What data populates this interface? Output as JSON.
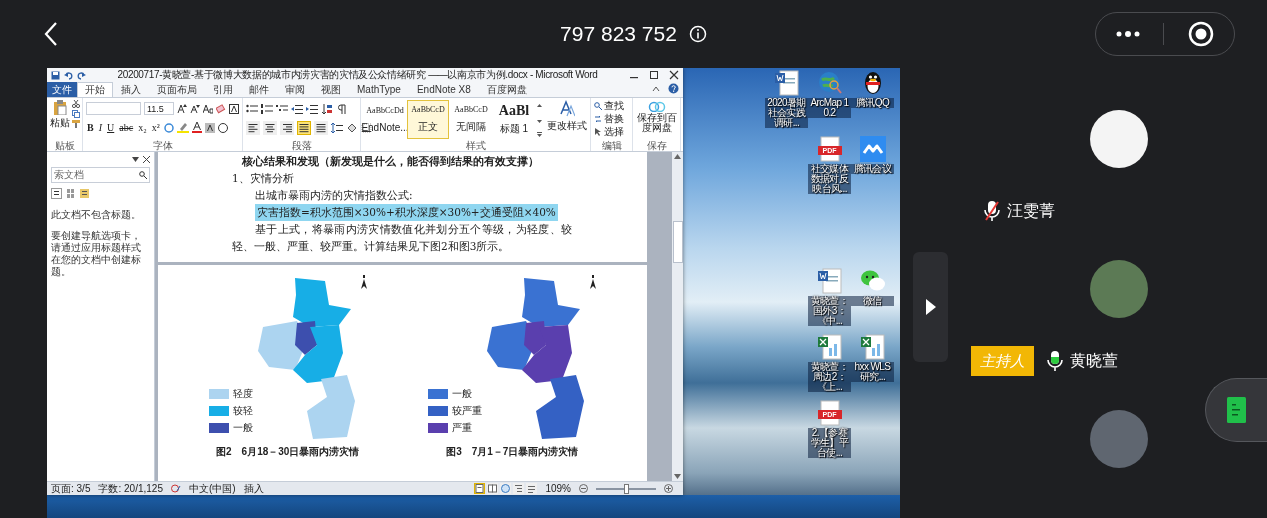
{
  "top_bar": {
    "meeting_id": "797 823 752"
  },
  "word": {
    "title": "20200717-黄晓萱-基于微博大数据的城市内涝灾害的灾情及公众情绪研究 ——以南京市为例.docx - Microsoft Word",
    "tabs": [
      {
        "label": "文件",
        "kind": "file",
        "selected": false
      },
      {
        "label": "开始",
        "kind": "tab",
        "selected": true
      },
      {
        "label": "插入",
        "kind": "tab",
        "selected": false
      },
      {
        "label": "页面布局",
        "kind": "tab",
        "selected": false
      },
      {
        "label": "引用",
        "kind": "tab",
        "selected": false
      },
      {
        "label": "邮件",
        "kind": "tab",
        "selected": false
      },
      {
        "label": "审阅",
        "kind": "tab",
        "selected": false
      },
      {
        "label": "视图",
        "kind": "tab",
        "selected": false
      },
      {
        "label": "MathType",
        "kind": "tab",
        "selected": false
      },
      {
        "label": "EndNote X8",
        "kind": "tab",
        "selected": false
      },
      {
        "label": "百度网盘",
        "kind": "tab",
        "selected": false
      }
    ],
    "ribbon": {
      "paste": "粘贴",
      "font_size": "11.5",
      "font_buttons": [
        "B",
        "I",
        "U",
        "abc",
        "x₂",
        "x²"
      ],
      "alignments": [
        {
          "kind": "left",
          "selected": false
        },
        {
          "kind": "center",
          "selected": false
        },
        {
          "kind": "right",
          "selected": false
        },
        {
          "kind": "justify",
          "selected": true
        },
        {
          "kind": "distributed",
          "selected": false
        }
      ],
      "styles": [
        {
          "sample": "AaBbCcDd",
          "name": "EndNote...",
          "kind": "normal",
          "selected": false
        },
        {
          "sample": "AaBbCcD",
          "name": "正文",
          "kind": "normal",
          "selected": true
        },
        {
          "sample": "AaBbCcD",
          "name": "无间隔",
          "kind": "normal",
          "selected": false
        },
        {
          "sample": "AaBl",
          "name": "标题 1",
          "kind": "heading",
          "selected": false
        }
      ],
      "change_styles": "更改样式",
      "editing": [
        "查找",
        "替换",
        "选择"
      ],
      "save_to_cloud": "保存到百度网盘",
      "groups": [
        "贴板",
        "字体",
        "段落",
        "样式",
        "编辑",
        "保存"
      ]
    },
    "nav_pane": {
      "search_placeholder": "索文档",
      "message": "此文档不包含标题。",
      "hint": "要创建导航选项卡，请通过应用标题样式在您的文档中创建标题。"
    },
    "document": {
      "heading": "核心结果和发现（新发现是什么，能否得到结果的有效支撑）",
      "section": "1、灾情分析",
      "intro": "出城市暴雨内涝的灾情指数公式:",
      "formula": {
        "text": "灾害指数=积水范围×30%+积水深度×30%+交通受阻×40%",
        "highlighted": true
      },
      "paragraph": "基于上式，将暴雨内涝灾情数值化并划分五个等级，为轻度、较轻、一般、严重、较严重。计算结果见下图2和图3所示。"
    },
    "figures": [
      {
        "caption": "图2　6月18－30日暴雨内涝灾情",
        "legend": [
          {
            "label": "轻度",
            "color": "#acd4f0"
          },
          {
            "label": "较轻",
            "color": "#17aee6"
          },
          {
            "label": "一般",
            "color": "#3d4fae"
          }
        ]
      },
      {
        "caption": "图3　7月1－7日暴雨内涝灾情",
        "legend": [
          {
            "label": "一般",
            "color": "#3a72d2"
          },
          {
            "label": "较严重",
            "color": "#3461c4"
          },
          {
            "label": "严重",
            "color": "#5a3fae"
          }
        ]
      }
    ],
    "status_bar": {
      "page": "页面: 3/5",
      "words": "字数: 20/1,125",
      "language": "中文(中国)",
      "mode": "插入",
      "views": [
        {
          "kind": "print",
          "selected": true
        },
        {
          "kind": "read",
          "selected": false
        },
        {
          "kind": "web",
          "selected": false
        },
        {
          "kind": "outline",
          "selected": false
        },
        {
          "kind": "draft",
          "selected": false
        }
      ],
      "zoom": "109%",
      "zoom_slider": {
        "level": 0.5
      }
    }
  },
  "desktop_icons": [
    {
      "kind": "word",
      "label": "2020暑期社会实践调研..."
    },
    {
      "kind": "arcmap",
      "label": "ArcMap 10.2"
    },
    {
      "kind": "qq",
      "label": "腾讯QQ"
    },
    {
      "kind": "pdf",
      "label": "社交媒体数据对反映台风...",
      "badge": "PDF"
    },
    {
      "kind": "meeting",
      "label": "腾讯会议"
    },
    {
      "kind": "word",
      "label": "黄晓萱：国外3：《中..."
    },
    {
      "kind": "wechat",
      "label": "微信"
    },
    {
      "kind": "excel",
      "label": "黄晓萱：周边2：《上..."
    },
    {
      "kind": "excel",
      "label": "hxx WLS研究..."
    },
    {
      "kind": "pdf",
      "label": "2.【参赛学生】平台使...",
      "badge": "PDF"
    }
  ],
  "participants": [
    {
      "kind": "cartoon",
      "name": "汪雯菁",
      "muted": true
    },
    {
      "kind": "photo",
      "name": "黄晓萱",
      "muted": false,
      "badge": "主持人"
    },
    {
      "kind": "photo_dark"
    }
  ]
}
